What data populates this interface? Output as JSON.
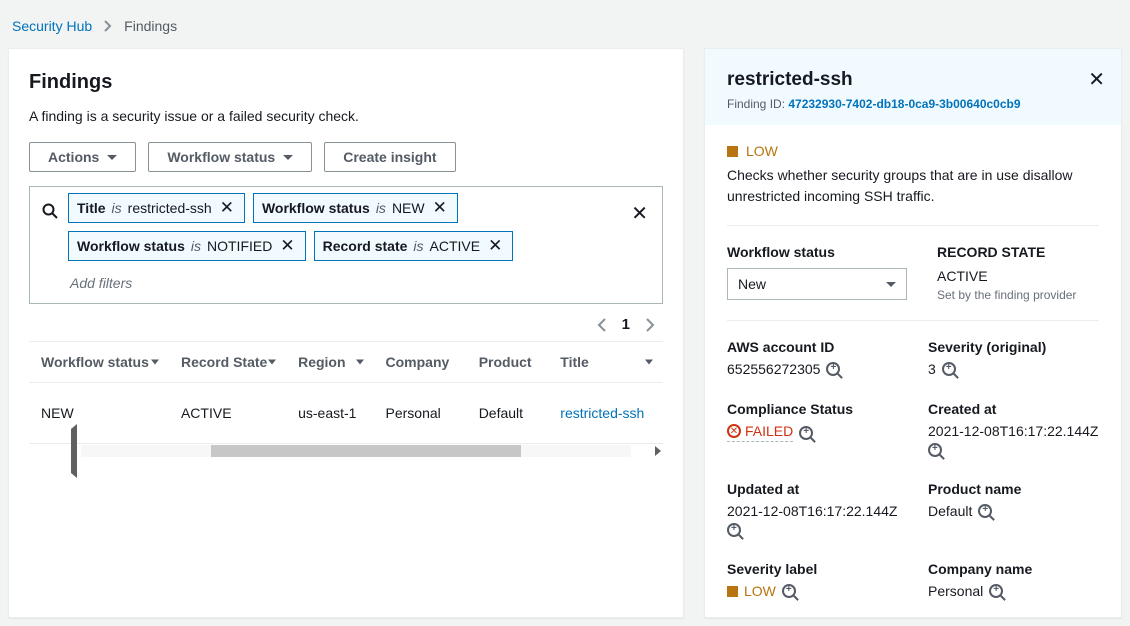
{
  "breadcrumb": {
    "root": "Security Hub",
    "current": "Findings"
  },
  "findings": {
    "title": "Findings",
    "subtitle": "A finding is a security issue or a failed security check.",
    "buttons": {
      "actions": "Actions",
      "workflow": "Workflow status",
      "insight": "Create insight"
    },
    "filters": [
      {
        "field": "Title",
        "op": "is",
        "value": "restricted-ssh"
      },
      {
        "field": "Workflow status",
        "op": "is",
        "value": "NEW"
      },
      {
        "field": "Workflow status",
        "op": "is",
        "value": "NOTIFIED"
      },
      {
        "field": "Record state",
        "op": "is",
        "value": "ACTIVE"
      }
    ],
    "add_filters_placeholder": "Add filters",
    "page": "1",
    "columns": [
      "Workflow status",
      "Record State",
      "Region",
      "Company",
      "Product",
      "Title"
    ],
    "rows": [
      {
        "workflow": "NEW",
        "state": "ACTIVE",
        "region": "us-east-1",
        "company": "Personal",
        "product": "Default",
        "title": "restricted-ssh"
      }
    ]
  },
  "detail": {
    "title": "restricted-ssh",
    "finding_id_label": "Finding ID: ",
    "finding_id": "47232930-7402-db18-0ca9-3b00640c0cb9",
    "severity_badge": "LOW",
    "description": "Checks whether security groups that are in use disallow unrestricted incoming SSH traffic.",
    "workflow_label": "Workflow status",
    "workflow_value": "New",
    "record_state_label": "RECORD STATE",
    "record_state_value": "ACTIVE",
    "record_state_note": "Set by the finding provider",
    "fields": {
      "aws_account_label": "AWS account ID",
      "aws_account": "652556272305",
      "severity_orig_label": "Severity (original)",
      "severity_orig": "3",
      "compliance_label": "Compliance Status",
      "compliance": "FAILED",
      "created_label": "Created at",
      "created": "2021-12-08T16:17:22.144Z",
      "updated_label": "Updated at",
      "updated": "2021-12-08T16:17:22.144Z",
      "product_label": "Product name",
      "product": "Default",
      "sev_label_label": "Severity label",
      "sev_label": "LOW",
      "company_label": "Company name",
      "company": "Personal"
    }
  }
}
